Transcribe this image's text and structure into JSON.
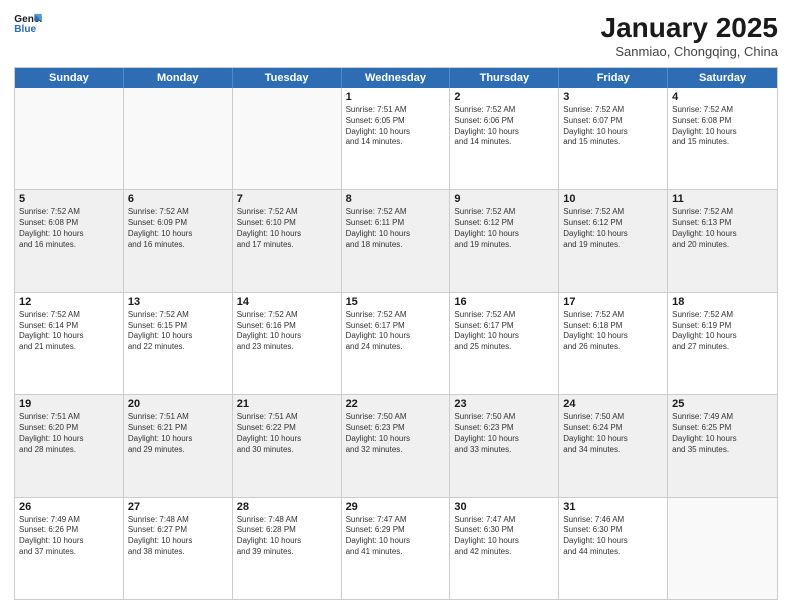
{
  "logo": {
    "line1": "General",
    "line2": "Blue"
  },
  "title": "January 2025",
  "subtitle": "Sanmiao, Chongqing, China",
  "headers": [
    "Sunday",
    "Monday",
    "Tuesday",
    "Wednesday",
    "Thursday",
    "Friday",
    "Saturday"
  ],
  "rows": [
    [
      {
        "day": "",
        "info": "",
        "empty": true
      },
      {
        "day": "",
        "info": "",
        "empty": true
      },
      {
        "day": "",
        "info": "",
        "empty": true
      },
      {
        "day": "1",
        "info": "Sunrise: 7:51 AM\nSunset: 6:05 PM\nDaylight: 10 hours\nand 14 minutes."
      },
      {
        "day": "2",
        "info": "Sunrise: 7:52 AM\nSunset: 6:06 PM\nDaylight: 10 hours\nand 14 minutes."
      },
      {
        "day": "3",
        "info": "Sunrise: 7:52 AM\nSunset: 6:07 PM\nDaylight: 10 hours\nand 15 minutes."
      },
      {
        "day": "4",
        "info": "Sunrise: 7:52 AM\nSunset: 6:08 PM\nDaylight: 10 hours\nand 15 minutes."
      }
    ],
    [
      {
        "day": "5",
        "info": "Sunrise: 7:52 AM\nSunset: 6:08 PM\nDaylight: 10 hours\nand 16 minutes."
      },
      {
        "day": "6",
        "info": "Sunrise: 7:52 AM\nSunset: 6:09 PM\nDaylight: 10 hours\nand 16 minutes."
      },
      {
        "day": "7",
        "info": "Sunrise: 7:52 AM\nSunset: 6:10 PM\nDaylight: 10 hours\nand 17 minutes."
      },
      {
        "day": "8",
        "info": "Sunrise: 7:52 AM\nSunset: 6:11 PM\nDaylight: 10 hours\nand 18 minutes."
      },
      {
        "day": "9",
        "info": "Sunrise: 7:52 AM\nSunset: 6:12 PM\nDaylight: 10 hours\nand 19 minutes."
      },
      {
        "day": "10",
        "info": "Sunrise: 7:52 AM\nSunset: 6:12 PM\nDaylight: 10 hours\nand 19 minutes."
      },
      {
        "day": "11",
        "info": "Sunrise: 7:52 AM\nSunset: 6:13 PM\nDaylight: 10 hours\nand 20 minutes."
      }
    ],
    [
      {
        "day": "12",
        "info": "Sunrise: 7:52 AM\nSunset: 6:14 PM\nDaylight: 10 hours\nand 21 minutes."
      },
      {
        "day": "13",
        "info": "Sunrise: 7:52 AM\nSunset: 6:15 PM\nDaylight: 10 hours\nand 22 minutes."
      },
      {
        "day": "14",
        "info": "Sunrise: 7:52 AM\nSunset: 6:16 PM\nDaylight: 10 hours\nand 23 minutes."
      },
      {
        "day": "15",
        "info": "Sunrise: 7:52 AM\nSunset: 6:17 PM\nDaylight: 10 hours\nand 24 minutes."
      },
      {
        "day": "16",
        "info": "Sunrise: 7:52 AM\nSunset: 6:17 PM\nDaylight: 10 hours\nand 25 minutes."
      },
      {
        "day": "17",
        "info": "Sunrise: 7:52 AM\nSunset: 6:18 PM\nDaylight: 10 hours\nand 26 minutes."
      },
      {
        "day": "18",
        "info": "Sunrise: 7:52 AM\nSunset: 6:19 PM\nDaylight: 10 hours\nand 27 minutes."
      }
    ],
    [
      {
        "day": "19",
        "info": "Sunrise: 7:51 AM\nSunset: 6:20 PM\nDaylight: 10 hours\nand 28 minutes."
      },
      {
        "day": "20",
        "info": "Sunrise: 7:51 AM\nSunset: 6:21 PM\nDaylight: 10 hours\nand 29 minutes."
      },
      {
        "day": "21",
        "info": "Sunrise: 7:51 AM\nSunset: 6:22 PM\nDaylight: 10 hours\nand 30 minutes."
      },
      {
        "day": "22",
        "info": "Sunrise: 7:50 AM\nSunset: 6:23 PM\nDaylight: 10 hours\nand 32 minutes."
      },
      {
        "day": "23",
        "info": "Sunrise: 7:50 AM\nSunset: 6:23 PM\nDaylight: 10 hours\nand 33 minutes."
      },
      {
        "day": "24",
        "info": "Sunrise: 7:50 AM\nSunset: 6:24 PM\nDaylight: 10 hours\nand 34 minutes."
      },
      {
        "day": "25",
        "info": "Sunrise: 7:49 AM\nSunset: 6:25 PM\nDaylight: 10 hours\nand 35 minutes."
      }
    ],
    [
      {
        "day": "26",
        "info": "Sunrise: 7:49 AM\nSunset: 6:26 PM\nDaylight: 10 hours\nand 37 minutes."
      },
      {
        "day": "27",
        "info": "Sunrise: 7:48 AM\nSunset: 6:27 PM\nDaylight: 10 hours\nand 38 minutes."
      },
      {
        "day": "28",
        "info": "Sunrise: 7:48 AM\nSunset: 6:28 PM\nDaylight: 10 hours\nand 39 minutes."
      },
      {
        "day": "29",
        "info": "Sunrise: 7:47 AM\nSunset: 6:29 PM\nDaylight: 10 hours\nand 41 minutes."
      },
      {
        "day": "30",
        "info": "Sunrise: 7:47 AM\nSunset: 6:30 PM\nDaylight: 10 hours\nand 42 minutes."
      },
      {
        "day": "31",
        "info": "Sunrise: 7:46 AM\nSunset: 6:30 PM\nDaylight: 10 hours\nand 44 minutes."
      },
      {
        "day": "",
        "info": "",
        "empty": true
      }
    ]
  ]
}
